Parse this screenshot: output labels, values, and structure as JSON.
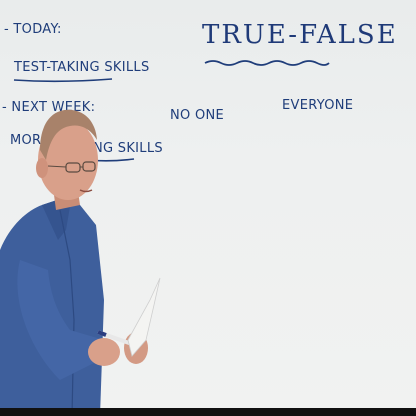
{
  "board": {
    "left_heading_1": "- TODAY:",
    "left_item_1": "TEST-TAKING SKILLS",
    "left_heading_2": "- NEXT WEEK:",
    "left_item_2_start": "MOR",
    "left_item_2_end": "KING SKILLS",
    "title": "TRUE-FALSE",
    "col_1": "NO ONE",
    "col_2": "EVERYONE"
  },
  "colors": {
    "marker": "#1f3d7a",
    "shirt": "#3e5f9c",
    "skin": "#d9a08a",
    "paper": "#f4f4f2"
  }
}
